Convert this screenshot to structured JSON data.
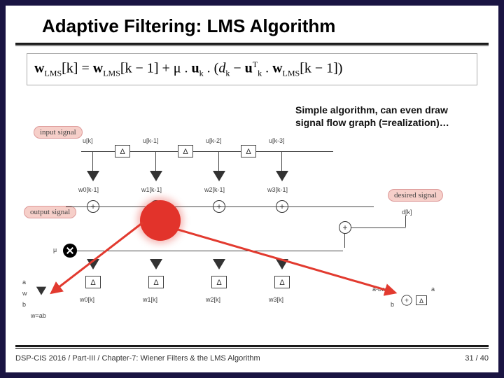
{
  "title": "Adaptive Filtering: LMS Algorithm",
  "equation": {
    "lhs_w": "w",
    "lhs_sub": "LMS",
    "k": "[k]",
    "eq": " = ",
    "rhs_w": "w",
    "rhs_sub": "LMS",
    "km1": "[k − 1]",
    "plus_mu": " + μ . ",
    "u": "u",
    "u_sub": "k",
    "dot1": " . (",
    "d": "d",
    "d_sub": "k",
    "minus": " − ",
    "u2": "u",
    "u2_sup": "T",
    "u2_sub": "k",
    "dot2": " . ",
    "w2": "w",
    "w2_sub": "LMS",
    "km1_2": "[k − 1])"
  },
  "note_line1": "Simple algorithm, can even draw",
  "note_line2": "signal flow graph (=realization)…",
  "labels": {
    "input_signal": "input signal",
    "output_signal": "output signal",
    "desired_signal": "desired signal",
    "delta": "Δ",
    "u_taps": [
      "u[k]",
      "u[k-1]",
      "u[k-2]",
      "u[k-3]"
    ],
    "w_top": [
      "w0[k-1]",
      "w1[k-1]",
      "w2[k-1]",
      "w3[k-1]"
    ],
    "w_bot": [
      "w0[k]",
      "w1[k]",
      "w2[k]",
      "w3[k]"
    ],
    "d": "d[k]",
    "mu": "μ",
    "a": "a",
    "b": "b",
    "w": "w",
    "wab": "w=ab",
    "abw": "a-bw",
    "plus": "+"
  },
  "footer_left": "DSP-CIS 2016  /  Part-III /  Chapter-7: Wiener Filters & the LMS Algorithm",
  "footer_right": "31 / 40"
}
